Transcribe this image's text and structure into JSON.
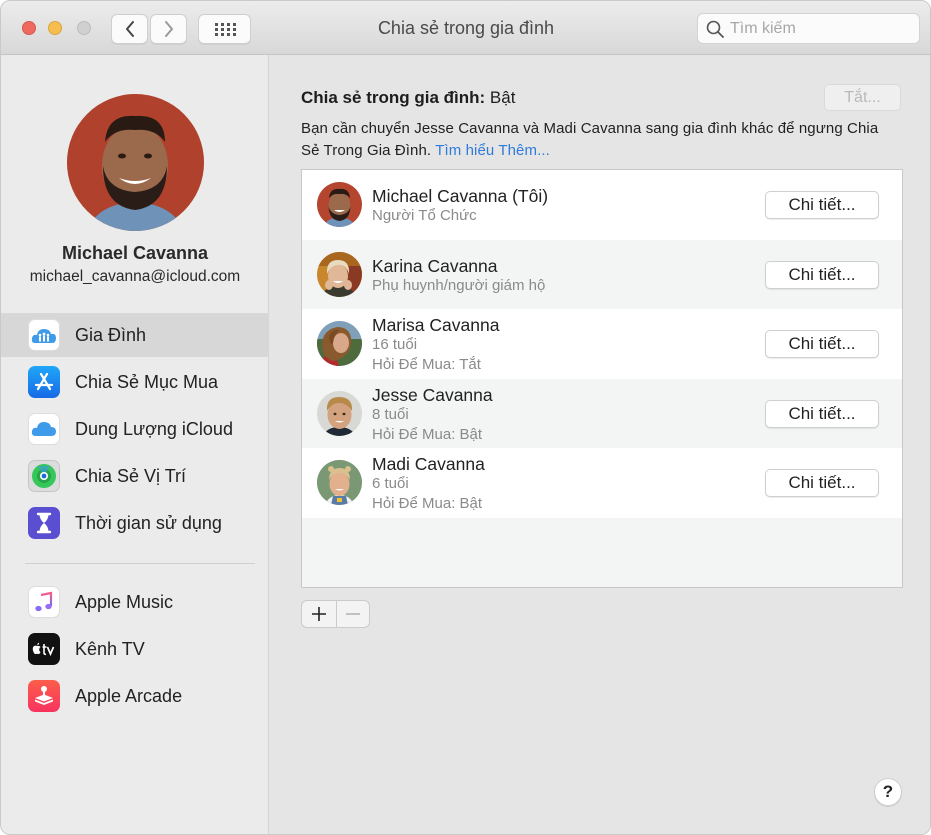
{
  "window": {
    "title": "Chia sẻ trong gia đình",
    "search_placeholder": "Tìm kiếm",
    "search_value": ""
  },
  "profile": {
    "name": "Michael Cavanna",
    "email": "michael_cavanna@icloud.com"
  },
  "sidebar": {
    "items": [
      {
        "label": "Gia Đình",
        "icon": "family-icon",
        "selected": true
      },
      {
        "label": "Chia Sẻ Mục Mua",
        "icon": "app-store-icon",
        "selected": false
      },
      {
        "label": "Dung Lượng iCloud",
        "icon": "icloud-icon",
        "selected": false
      },
      {
        "label": "Chia Sẻ Vị Trí",
        "icon": "find-my-icon",
        "selected": false
      },
      {
        "label": "Thời gian sử dụng",
        "icon": "screen-time-icon",
        "selected": false
      }
    ],
    "services": [
      {
        "label": "Apple Music",
        "icon": "apple-music-icon"
      },
      {
        "label": "Kênh TV",
        "icon": "apple-tv-icon"
      },
      {
        "label": "Apple Arcade",
        "icon": "apple-arcade-icon"
      }
    ]
  },
  "main": {
    "status_label": "Chia sẻ trong gia đình:",
    "status_value": "Bật",
    "off_button": "Tắt...",
    "notice_text": "Bạn cần chuyển Jesse Cavanna và Madi Cavanna sang gia đình khác để ngưng Chia Sẻ Trong Gia Đình.",
    "learn_more": "Tìm hiểu Thêm...",
    "members": [
      {
        "name": "Michael Cavanna (Tôi)",
        "lines": [
          "Người Tổ Chức"
        ],
        "button": "Chi tiết..."
      },
      {
        "name": "Karina Cavanna",
        "lines": [
          "Phụ huynh/người giám hộ"
        ],
        "button": "Chi tiết..."
      },
      {
        "name": "Marisa Cavanna",
        "lines": [
          "16 tuổi",
          "Hỏi Để Mua: Tắt"
        ],
        "button": "Chi tiết..."
      },
      {
        "name": "Jesse Cavanna",
        "lines": [
          "8 tuổi",
          "Hỏi Để Mua: Bật"
        ],
        "button": "Chi tiết..."
      },
      {
        "name": "Madi Cavanna",
        "lines": [
          "6 tuổi",
          "Hỏi Để Mua: Bật"
        ],
        "button": "Chi tiết..."
      }
    ],
    "add_symbol": "+",
    "remove_symbol": "−",
    "help_symbol": "?"
  },
  "colors": {
    "link": "#2f7bdb",
    "selected_row": "#d7d7d7",
    "close": "#ee6a5f",
    "minimize": "#f5be4f"
  }
}
